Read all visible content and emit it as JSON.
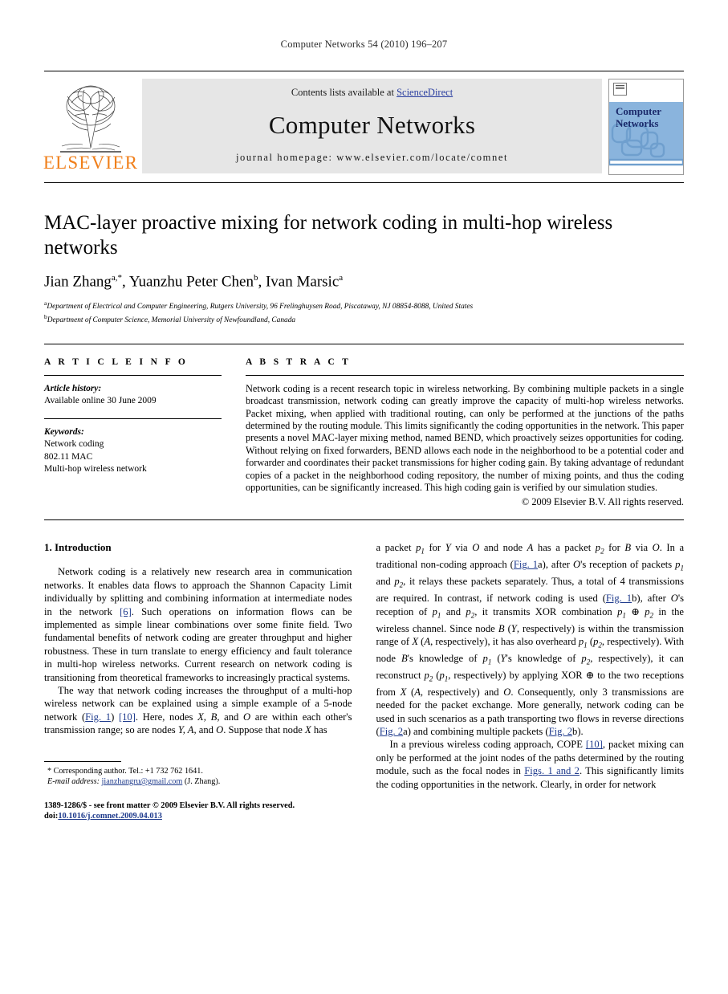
{
  "running_head": "Computer Networks 54 (2010) 196–207",
  "masthead": {
    "publisher_name": "ELSEVIER",
    "contents_prefix": "Contents lists available at ",
    "sciencedirect": "ScienceDirect",
    "journal_name": "Computer Networks",
    "homepage": "journal homepage: www.elsevier.com/locate/comnet",
    "cover_title_line1": "Computer",
    "cover_title_line2": "Networks",
    "accent_orange": "#F07F1A",
    "link_blue": "#2B3FA0",
    "cover_blue": "#8AB4DD"
  },
  "title": "MAC-layer proactive mixing for network coding in multi-hop wireless networks",
  "authors_parts": {
    "a1": "Jian Zhang",
    "sup1": "a,*",
    "sep1": ", ",
    "a2": "Yuanzhu Peter Chen",
    "sup2": "b",
    "sep2": ", ",
    "a3": "Ivan Marsic",
    "sup3": "a"
  },
  "affiliations": [
    {
      "sup": "a",
      "text": "Department of Electrical and Computer Engineering, Rutgers University, 96 Frelinghuysen Road, Piscataway, NJ 08854-8088, United States"
    },
    {
      "sup": "b",
      "text": "Department of Computer Science, Memorial University of Newfoundland, Canada"
    }
  ],
  "article_info": {
    "heading": "A R T I C L E   I N F O",
    "history_label": "Article history:",
    "history_value": "Available online 30 June 2009",
    "keywords_label": "Keywords:",
    "keywords": [
      "Network coding",
      "802.11 MAC",
      "Multi-hop wireless network"
    ]
  },
  "abstract": {
    "heading": "A B S T R A C T",
    "text": "Network coding is a recent research topic in wireless networking. By combining multiple packets in a single broadcast transmission, network coding can greatly improve the capacity of multi-hop wireless networks. Packet mixing, when applied with traditional routing, can only be performed at the junctions of the paths determined by the routing module. This limits significantly the coding opportunities in the network. This paper presents a novel MAC-layer mixing method, named BEND, which proactively seizes opportunities for coding. Without relying on fixed forwarders, BEND allows each node in the neighborhood to be a potential coder and forwarder and coordinates their packet transmissions for higher coding gain. By taking advantage of redundant copies of a packet in the neighborhood coding repository, the number of mixing points, and thus the coding opportunities, can be significantly increased. This high coding gain is verified by our simulation studies.",
    "copyright": "© 2009 Elsevier B.V. All rights reserved."
  },
  "section": {
    "number_title": "1. Introduction"
  },
  "left_column": {
    "para1_a": "Network coding is a relatively new research area in communication networks. It enables data flows to approach the Shannon Capacity Limit individually by splitting and combining information at intermediate nodes in the network ",
    "para1_ref": "[6]",
    "para1_b": ". Such operations on information flows can be implemented as simple linear combinations over some finite field. Two fundamental benefits of network coding are greater throughput and higher robustness. These in turn translate to energy efficiency and fault tolerance in multi-hop wireless networks. Current research on network coding is transitioning from theoretical frameworks to increasingly practical systems.",
    "para2_a": "The way that network coding increases the throughput of a multi-hop wireless network can be explained using a simple example of a 5-node network (",
    "para2_fig": "Fig. 1",
    "para2_b": ") ",
    "para2_ref": "[10]",
    "para2_c": ". Here, nodes ",
    "para2_v1": "X, B",
    "para2_d": ", and ",
    "para2_v2": "O",
    "para2_e": " are within each other's transmission range; so are nodes ",
    "para2_v3": "Y, A",
    "para2_f": ", and ",
    "para2_v4": "O",
    "para2_g": ". Suppose that node ",
    "para2_v5": "X",
    "para2_h": " has"
  },
  "right_column": {
    "p1_1": "a packet ",
    "p1_p1": "p",
    "p1_p1sub": "1",
    "p1_2": " for ",
    "p1_Y": "Y",
    "p1_3": " via ",
    "p1_O": "O",
    "p1_4": " and node ",
    "p1_A": "A",
    "p1_5": " has a packet ",
    "p1_p2": "p",
    "p1_p2sub": "2",
    "p1_6": " for ",
    "p1_B": "B",
    "p1_7": " via ",
    "p1_O2": "O",
    "p1_8": ". In a traditional non-coding approach (",
    "p1_fig1a": "Fig. 1",
    "p1_9": "a), after ",
    "p1_O3": "O",
    "p1_10": "'s reception of packets ",
    "p1_11": " and ",
    "p1_12": ", it relays these packets separately. Thus, a total of 4 transmissions are required. In contrast, if network coding is used (",
    "p1_fig1b": "Fig. 1",
    "p1_13": "b), after ",
    "p1_14": "'s reception of ",
    "p1_15": " and ",
    "p1_16": ", it transmits XOR combination ",
    "p1_xor": "p₁ ⊕ p₂",
    "p1_17": " in the wireless channel. Since node ",
    "p1_18": " (",
    "p1_19": ", respectively) is within the transmission range of ",
    "p1_X": "X",
    "p1_20": " (",
    "p1_21": ", respectively), it has also overheard ",
    "p1_22": " (",
    "p1_23": ", respectively). With node ",
    "p1_24": "'s knowledge of ",
    "p1_25": " (",
    "p1_26": "'s knowledge of ",
    "p1_27": ", respectively), it can reconstruct ",
    "p1_28": " (",
    "p1_29": ", respectively) by applying XOR ⊕ to the two receptions from ",
    "p1_30": " (",
    "p1_31": ", respectively) and ",
    "p1_32": ". Consequently, only 3 transmissions are needed for the packet exchange. More generally, network coding can be used in such scenarios as a path transporting two flows in reverse directions (",
    "p1_fig2a": "Fig. 2",
    "p1_33": "a) and combining multiple packets (",
    "p1_fig2b": "Fig. 2",
    "p1_34": "b).",
    "p2_1": "In a previous wireless coding approach, COPE ",
    "p2_ref": "[10]",
    "p2_2": ", packet mixing can only be performed at the joint nodes of the paths determined by the routing module, such as the focal nodes in ",
    "p2_figs": "Figs. 1 and 2",
    "p2_3": ". This significantly limits the coding opportunities in the network. Clearly, in order for network"
  },
  "footnotes": {
    "corresponding": "* Corresponding author. Tel.: +1 732 762 1641.",
    "email_label": "E-mail address:",
    "email": "jianzhangru@gmail.com",
    "email_suffix": " (J. Zhang).",
    "issn_line": "1389-1286/$ - see front matter © 2009 Elsevier B.V. All rights reserved.",
    "doi_prefix": "doi:",
    "doi_value": "10.1016/j.comnet.2009.04.013"
  }
}
